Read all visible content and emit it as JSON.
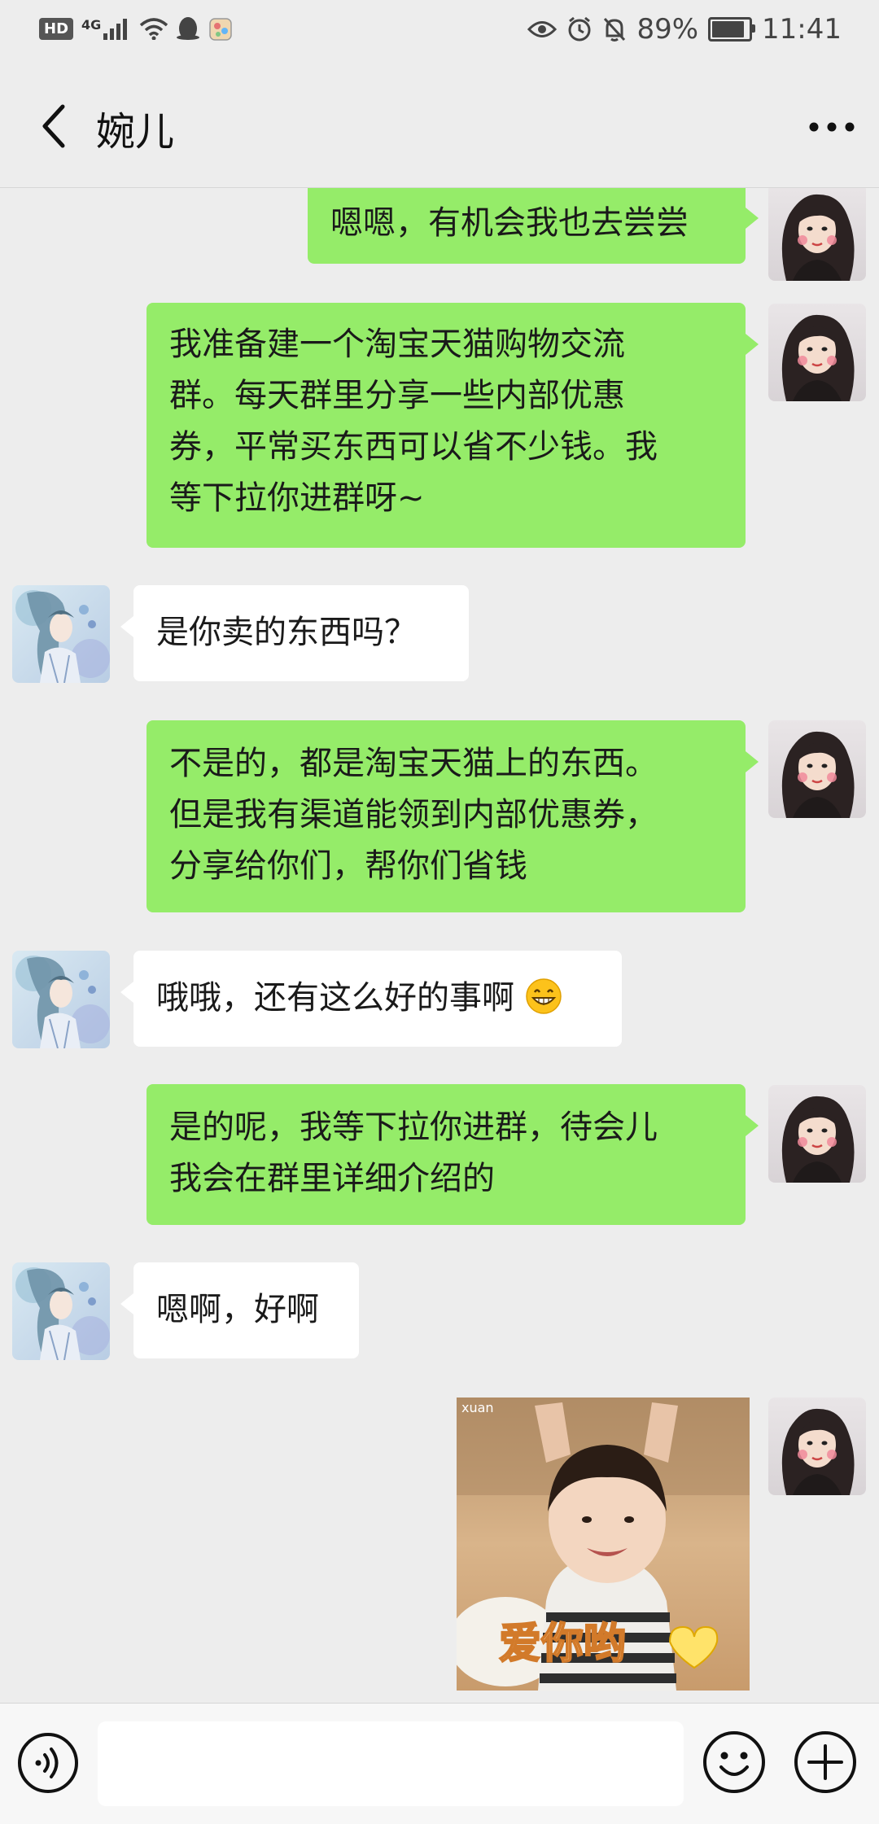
{
  "status_bar": {
    "hd": "HD",
    "network": "4G",
    "battery_percent": "89%",
    "battery_level": 0.89,
    "time": "11:41"
  },
  "nav": {
    "title": "婉儿"
  },
  "messages": [
    {
      "side": "me",
      "text": "嗯嗯，有机会我也去尝尝"
    },
    {
      "side": "me",
      "lines": [
        "我准备建一个淘宝天猫购物交流",
        "群。每天群里分享一些内部优惠",
        "券，平常买东西可以省不少钱。我",
        "等下拉你进群呀~"
      ]
    },
    {
      "side": "other",
      "text": "是你卖的东西吗？"
    },
    {
      "side": "me",
      "lines": [
        "不是的，都是淘宝天猫上的东西。",
        "但是我有渠道能领到内部优惠券，",
        "分享给你们，帮你们省钱"
      ]
    },
    {
      "side": "other",
      "text": "哦哦，还有这么好的事啊"
    },
    {
      "side": "me",
      "lines": [
        "是的呢，我等下拉你进群，待会儿",
        "我会在群里详细介绍的"
      ]
    },
    {
      "side": "other",
      "text": "嗯啊，好啊"
    },
    {
      "side": "me",
      "sticker_watermark": "xuan",
      "sticker_caption": "爱你哟"
    }
  ],
  "colors": {
    "my_bubble": "#95ec69",
    "other_bubble": "#ffffff",
    "background": "#ededed"
  },
  "icons": {
    "back": "chevron-left-icon",
    "more": "more-dots-icon",
    "voice": "voice-icon",
    "emoji": "emoji-icon",
    "plus": "plus-icon"
  }
}
